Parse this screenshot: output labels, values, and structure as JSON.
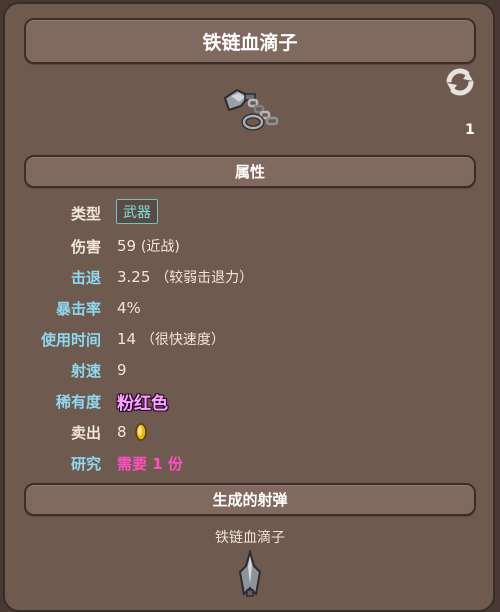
{
  "item": {
    "name": "铁链血滴子",
    "stack_count": "1",
    "icon": "chain-flail-icon"
  },
  "attributes_header": "属性",
  "attributes": {
    "type_label": "类型",
    "type_value": "武器",
    "damage_label": "伤害",
    "damage_value": "59",
    "damage_note": "(近战)",
    "knockback_label": "击退",
    "knockback_value": "3.25",
    "knockback_note": "（较弱击退力）",
    "crit_label": "暴击率",
    "crit_value": "4%",
    "usetime_label": "使用时间",
    "usetime_value": "14",
    "usetime_note": "（很快速度）",
    "shootspeed_label": "射速",
    "shootspeed_value": "9",
    "rarity_label": "稀有度",
    "rarity_value": "粉红色",
    "sell_label": "卖出",
    "sell_value": "8",
    "research_label": "研究",
    "research_value": "需要 1 份"
  },
  "projectile_header": "生成的射弹",
  "projectile": {
    "name": "铁链血滴子",
    "icon": "projectile-icon"
  },
  "colors": {
    "background": "#483a33",
    "panel": "#6f5a4f",
    "bar": "#806a5f",
    "label_cyan": "#8fd8f0",
    "rarity_pink": "#f8a6ff",
    "research_pink": "#ff4fc3",
    "tag_border": "#6cc6c3"
  },
  "icons": {
    "refresh": "refresh-icon",
    "coin": "gold-coin-icon"
  }
}
